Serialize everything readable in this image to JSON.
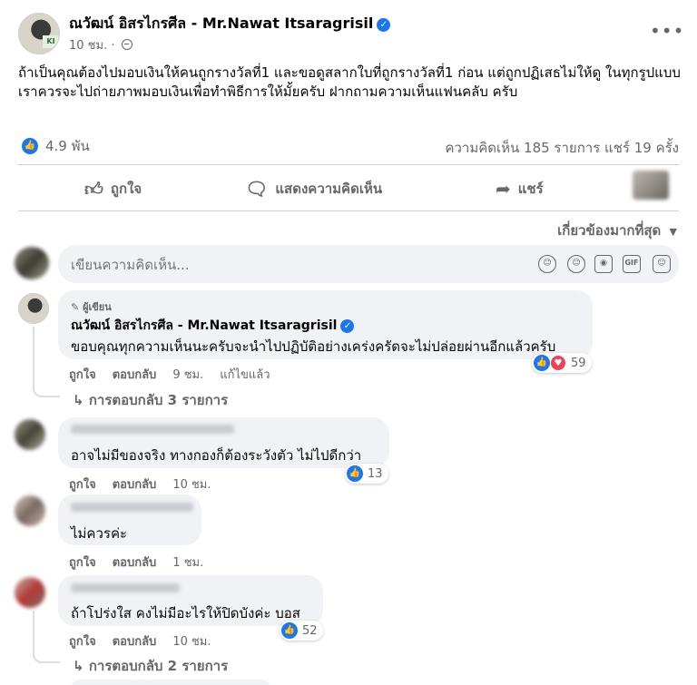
{
  "post": {
    "author": "ณวัฒน์ อิสรไกรศีล - Mr.Nawat Itsaragrisil",
    "time": "10 ชม.",
    "separator": "·",
    "avatar_tag": "KI",
    "body": "ถ้าเป็นคุณต้องไปมอบเงินให้คนถูกรางวัลที่1 และขอดูสลากใบที่ถูกรางวัลที่1 ก่อน แต่ถูกปฏิเสธไม่ให้ดู ในทุกรูปแบบ เราควรจะไปถ่ายภาพมอบเงินเพื่อทำพิธีการให้มั้ยครับ ฝากถามความเห็นแฟนคลับ ครับ",
    "reactions_count": "4.9 พัน",
    "comments_stat": "ความคิดเห็น 185 รายการ",
    "shares_stat": "แชร์ 19 ครั้ง",
    "more_icon": "more-options-icon"
  },
  "actions": {
    "like": "ถูกใจ",
    "comment": "แสดงความคิดเห็น",
    "share": "แชร์"
  },
  "sort_label": "เกี่ยวข้องมากที่สุด",
  "composer": {
    "placeholder": "เขียนความคิดเห็น...",
    "icons": [
      "avatar-sticker-icon",
      "emoji-icon",
      "camera-icon",
      "gif-icon",
      "sticker-icon"
    ],
    "gif_label": "GIF"
  },
  "comments": [
    {
      "badge": "ผู้เขียน",
      "name": "ณวัฒน์ อิสรไกรศีล - Mr.Nawat Itsaragrisil",
      "text": "ขอบคุณทุกความเห็นนะครับจะนำไปปฏิบัติอย่างเคร่งครัดจะไม่ปล่อยผ่านอีกแล้วครับ",
      "like": "ถูกใจ",
      "reply": "ตอบกลับ",
      "time": "9 ชม.",
      "edited": "แก้ไขแล้ว",
      "reactions": "59",
      "replies": "การตอบกลับ 3 รายการ"
    },
    {
      "text": "อาจไม่มีของจริง ทางกองก็ต้องระวังตัว ไม่ไปดีกว่า",
      "like": "ถูกใจ",
      "reply": "ตอบกลับ",
      "time": "10 ชม.",
      "reactions": "13"
    },
    {
      "text": "ไม่ควรค่ะ",
      "like": "ถูกใจ",
      "reply": "ตอบกลับ",
      "time": "1 ชม."
    },
    {
      "text": "ถ้าโปร่งใส คงไม่มีอะไรให้ปิดบังค่ะ บอส",
      "like": "ถูกใจ",
      "reply": "ตอบกลับ",
      "time": "10 ชม.",
      "reactions": "52",
      "replies": "การตอบกลับ 2 รายการ"
    }
  ],
  "colors": {
    "brand_blue": "#1877f2",
    "love_red": "#f33e58",
    "secondary_text": "#65676b",
    "bubble_bg": "#f0f2f5"
  }
}
